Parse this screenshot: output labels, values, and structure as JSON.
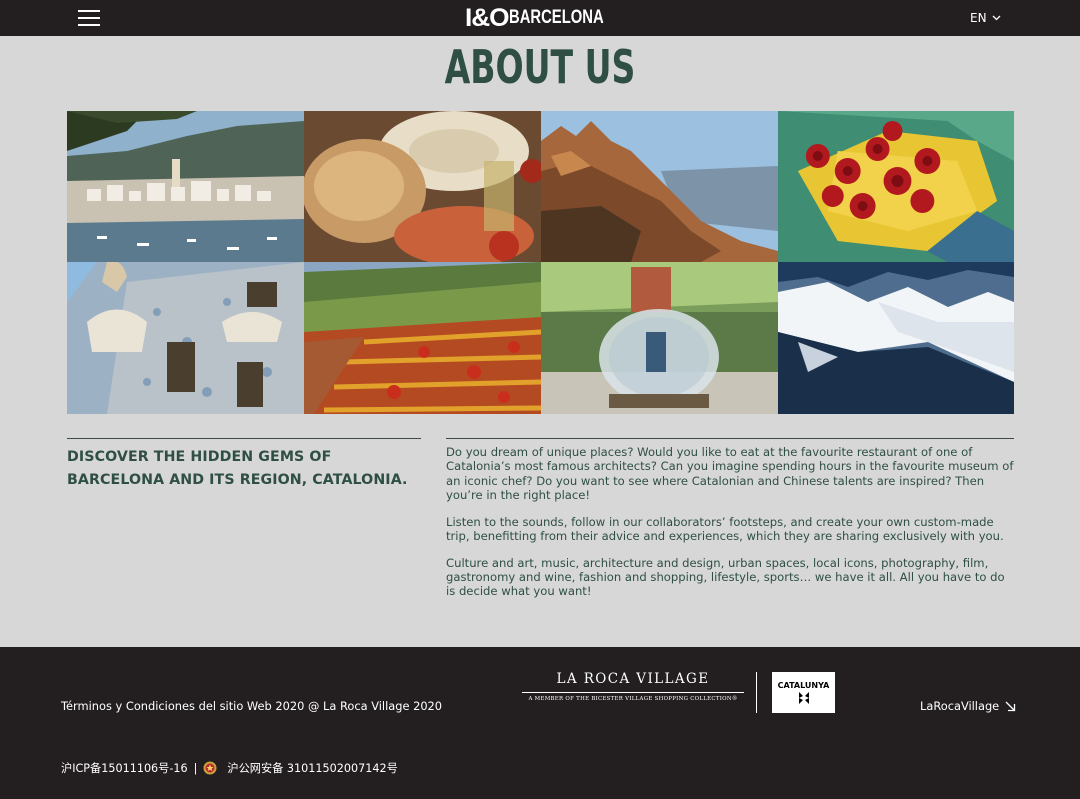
{
  "header": {
    "menu_icon": "hamburger-menu-icon",
    "logo_mark": "I&O",
    "logo_text": "BARCELONA",
    "language": "EN",
    "language_icon": "chevron-down-icon"
  },
  "page_title": "ABOUT US",
  "gallery": {
    "images": [
      {
        "subject": "coastal-village-harbor"
      },
      {
        "subject": "bread-and-tomato-table"
      },
      {
        "subject": "montserrat-mountains"
      },
      {
        "subject": "red-roses-bouquet"
      },
      {
        "subject": "gaudi-facade"
      },
      {
        "subject": "vineyard-autumn"
      },
      {
        "subject": "village-glass-dome"
      },
      {
        "subject": "snowy-pyrenees"
      }
    ]
  },
  "intro": {
    "tagline": "DISCOVER THE HIDDEN GEMS OF BARCELONA AND ITS REGION, CATALONIA.",
    "paragraphs": [
      "Do you dream of unique places? Would you like to eat at the favourite restaurant of one of Catalonia’s most famous architects? Can you imagine spending hours in the favourite museum of an iconic chef? Do you want to see where Catalonian and Chinese talents are inspired? Then you’re in the right place!",
      "Listen to the sounds, follow in our collaborators’ footsteps, and create your own custom-made trip, benefitting from their advice and experiences, which they are sharing exclusively with you.",
      "Culture and art, music, architecture and design, urban spaces, local icons, photography, film, gastronomy and wine, fashion and shopping, lifestyle, sports… we have it all. All you have to do is decide what you want!"
    ]
  },
  "footer": {
    "terms": "Términos y Condiciones del sitio Web 2020 @ La Roca Village 2020",
    "partner_logo_name": "LA ROCA VILLAGE",
    "partner_logo_sub": "A MEMBER OF THE BICESTER VILLAGE SHOPPING COLLECTION®",
    "catalunya_logo": "CATALUNYA",
    "social_link": "LaRocaVillage",
    "social_icon": "arrow-down-right-icon",
    "icp": "沪ICP备15011106号-16",
    "separator": "|",
    "police_icon": "police-badge-icon",
    "police_record": "沪公网安备 31011502007142号"
  }
}
